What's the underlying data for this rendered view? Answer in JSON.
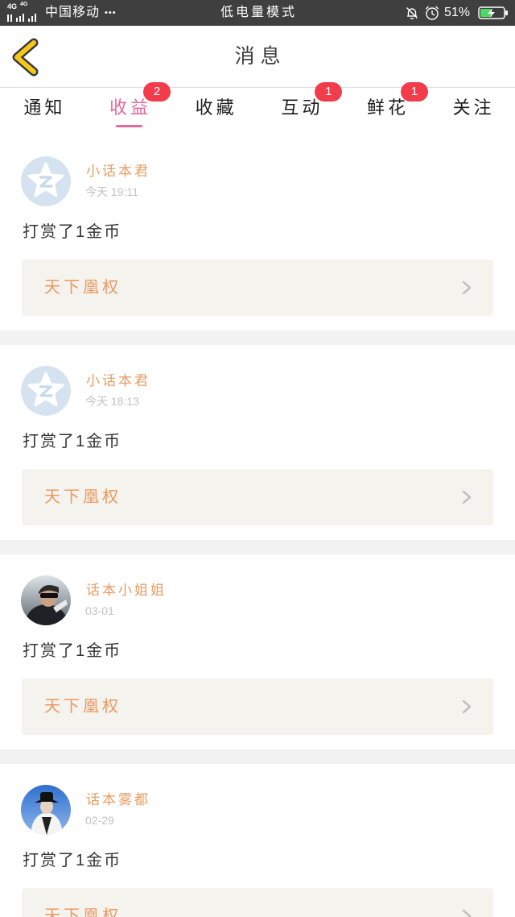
{
  "status_bar": {
    "network_labels": [
      "4G",
      "4G"
    ],
    "carrier": "中国移动",
    "more": "•••",
    "mode": "低电量模式",
    "battery_percent": "51%",
    "battery_level": 0.51,
    "icons": {
      "signal": "signal-bars-icon",
      "silent": "bell-off-icon",
      "alarm": "alarm-icon",
      "battery": "battery-charging-icon"
    }
  },
  "header": {
    "back_icon": "chevron-left-icon",
    "title": "消息"
  },
  "tabs": [
    {
      "label": "通知",
      "active": false
    },
    {
      "label": "收益",
      "badge": "2",
      "active": true
    },
    {
      "label": "收藏",
      "active": false
    },
    {
      "label": "互动",
      "badge": "1",
      "active": false
    },
    {
      "label": "鲜花",
      "badge": "1",
      "active": false
    },
    {
      "label": "关注",
      "active": false
    }
  ],
  "messages": [
    {
      "avatar": "default-avatar",
      "name": "小话本君",
      "time": "今天 19:11",
      "text": "打赏了1金币",
      "link": "天下凰权",
      "link_icon": "chevron-right-icon"
    },
    {
      "avatar": "default-avatar",
      "name": "小话本君",
      "time": "今天 18:13",
      "text": "打赏了1金币",
      "link": "天下凰权",
      "link_icon": "chevron-right-icon"
    },
    {
      "avatar": "photo-avatar",
      "name": "话本小姐姐",
      "time": "03-01",
      "text": "打赏了1金币",
      "link": "天下凰权",
      "link_icon": "chevron-right-icon"
    },
    {
      "avatar": "photo-avatar",
      "name": "话本雾都",
      "time": "02-29",
      "text": "打赏了1金币",
      "link": "天下凰权",
      "link_icon": "chevron-right-icon"
    }
  ],
  "colors": {
    "status_bar": "#3f3f3f",
    "back_icon": "#f6c81a",
    "active_tab": "#e8689b",
    "badge": "#f23c4b",
    "sender_name": "#e99b61",
    "book_link": "#ea9962",
    "link_box": "#f4f3ed",
    "divider": "#f2f2f2",
    "battery_fill": "#4cd964"
  }
}
